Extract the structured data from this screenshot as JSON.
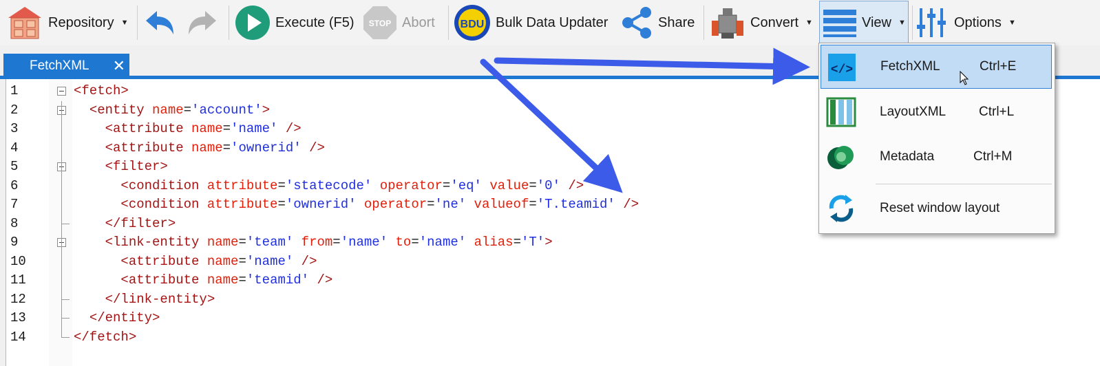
{
  "toolbar": {
    "repository": "Repository",
    "execute": "Execute (F5)",
    "abort_badge": "STOP",
    "abort": "Abort",
    "bdu_badge": "BDU",
    "bulk": "Bulk Data Updater",
    "share": "Share",
    "convert": "Convert",
    "view": "View",
    "options": "Options"
  },
  "tab": {
    "label": "FetchXML",
    "close": "✕"
  },
  "editor": {
    "lines": [
      {
        "n": "1",
        "parts": [
          [
            "t",
            "<fetch>"
          ]
        ]
      },
      {
        "n": "2",
        "parts": [
          [
            "p",
            "  "
          ],
          [
            "t",
            "<entity "
          ],
          [
            "a",
            "name"
          ],
          [
            "p",
            "="
          ],
          [
            "v",
            "'account'"
          ],
          [
            "t",
            ">"
          ]
        ]
      },
      {
        "n": "3",
        "parts": [
          [
            "p",
            "    "
          ],
          [
            "t",
            "<attribute "
          ],
          [
            "a",
            "name"
          ],
          [
            "p",
            "="
          ],
          [
            "v",
            "'name'"
          ],
          [
            "t",
            " />"
          ]
        ]
      },
      {
        "n": "4",
        "parts": [
          [
            "p",
            "    "
          ],
          [
            "t",
            "<attribute "
          ],
          [
            "a",
            "name"
          ],
          [
            "p",
            "="
          ],
          [
            "v",
            "'ownerid'"
          ],
          [
            "t",
            " />"
          ]
        ]
      },
      {
        "n": "5",
        "parts": [
          [
            "p",
            "    "
          ],
          [
            "t",
            "<filter>"
          ]
        ]
      },
      {
        "n": "6",
        "parts": [
          [
            "p",
            "      "
          ],
          [
            "t",
            "<condition "
          ],
          [
            "a",
            "attribute"
          ],
          [
            "p",
            "="
          ],
          [
            "v",
            "'statecode'"
          ],
          [
            "a",
            " operator"
          ],
          [
            "p",
            "="
          ],
          [
            "v",
            "'eq'"
          ],
          [
            "a",
            " value"
          ],
          [
            "p",
            "="
          ],
          [
            "v",
            "'0'"
          ],
          [
            "t",
            " />"
          ]
        ]
      },
      {
        "n": "7",
        "parts": [
          [
            "p",
            "      "
          ],
          [
            "t",
            "<condition "
          ],
          [
            "a",
            "attribute"
          ],
          [
            "p",
            "="
          ],
          [
            "v",
            "'ownerid'"
          ],
          [
            "a",
            " operator"
          ],
          [
            "p",
            "="
          ],
          [
            "v",
            "'ne'"
          ],
          [
            "a",
            " valueof"
          ],
          [
            "p",
            "="
          ],
          [
            "v",
            "'T.teamid'"
          ],
          [
            "t",
            " />"
          ]
        ]
      },
      {
        "n": "8",
        "parts": [
          [
            "p",
            "    "
          ],
          [
            "t",
            "</filter>"
          ]
        ]
      },
      {
        "n": "9",
        "parts": [
          [
            "p",
            "    "
          ],
          [
            "t",
            "<link-entity "
          ],
          [
            "a",
            "name"
          ],
          [
            "p",
            "="
          ],
          [
            "v",
            "'team'"
          ],
          [
            "a",
            " from"
          ],
          [
            "p",
            "="
          ],
          [
            "v",
            "'name'"
          ],
          [
            "a",
            " to"
          ],
          [
            "p",
            "="
          ],
          [
            "v",
            "'name'"
          ],
          [
            "a",
            " alias"
          ],
          [
            "p",
            "="
          ],
          [
            "v",
            "'T'"
          ],
          [
            "t",
            ">"
          ]
        ]
      },
      {
        "n": "10",
        "parts": [
          [
            "p",
            "      "
          ],
          [
            "t",
            "<attribute "
          ],
          [
            "a",
            "name"
          ],
          [
            "p",
            "="
          ],
          [
            "v",
            "'name'"
          ],
          [
            "t",
            " />"
          ]
        ]
      },
      {
        "n": "11",
        "parts": [
          [
            "p",
            "      "
          ],
          [
            "t",
            "<attribute "
          ],
          [
            "a",
            "name"
          ],
          [
            "p",
            "="
          ],
          [
            "v",
            "'teamid'"
          ],
          [
            "t",
            " />"
          ]
        ]
      },
      {
        "n": "12",
        "parts": [
          [
            "p",
            "    "
          ],
          [
            "t",
            "</link-entity>"
          ]
        ]
      },
      {
        "n": "13",
        "parts": [
          [
            "p",
            "  "
          ],
          [
            "t",
            "</entity>"
          ]
        ]
      },
      {
        "n": "14",
        "parts": [
          [
            "t",
            "</fetch>"
          ]
        ]
      }
    ]
  },
  "view_menu": {
    "items": [
      {
        "label": "FetchXML",
        "shortcut": "Ctrl+E",
        "icon": "code-icon"
      },
      {
        "label": "LayoutXML",
        "shortcut": "Ctrl+L",
        "icon": "columns-icon"
      },
      {
        "label": "Metadata",
        "shortcut": "Ctrl+M",
        "icon": "dataverse-icon"
      },
      {
        "label": "Reset window layout",
        "shortcut": "",
        "icon": "refresh-icon"
      }
    ]
  }
}
